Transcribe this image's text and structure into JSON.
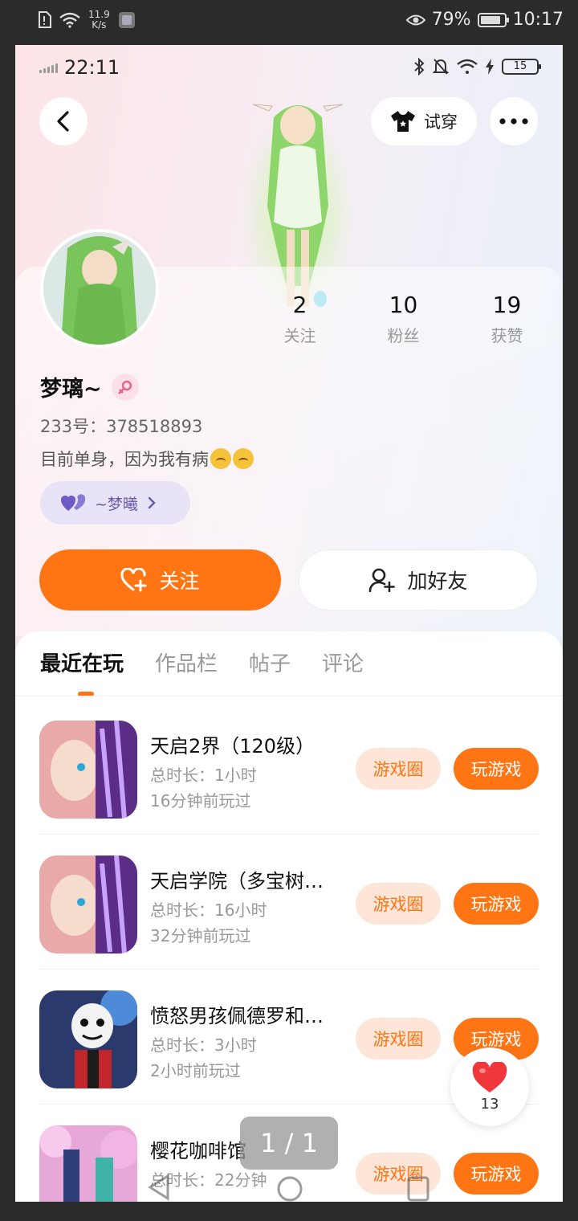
{
  "outer_status": {
    "speed_value": "11.9",
    "speed_unit": "K/s",
    "battery": "79%",
    "time": "10:17"
  },
  "inner_status": {
    "time": "22:11",
    "battery": "15"
  },
  "header": {
    "tryon_label": "试穿"
  },
  "profile": {
    "stats": [
      {
        "value": "2",
        "label": "关注"
      },
      {
        "value": "10",
        "label": "粉丝"
      },
      {
        "value": "19",
        "label": "获赞"
      }
    ],
    "username": "梦璃~",
    "uid": "233号：378518893",
    "bio": "目前单身，因为我有病",
    "relation_name": "~梦曦",
    "follow_label": "关注",
    "add_friend_label": "加好友"
  },
  "tabs": [
    {
      "label": "最近在玩",
      "active": true
    },
    {
      "label": "作品栏",
      "active": false
    },
    {
      "label": "帖子",
      "active": false
    },
    {
      "label": "评论",
      "active": false
    }
  ],
  "games": [
    {
      "title": "天启2界（120级）",
      "duration": "总时长：1小时",
      "last_played": "16分钟前玩过",
      "circle_label": "游戏圈",
      "play_label": "玩游戏"
    },
    {
      "title": "天启学院（多宝树…",
      "duration": "总时长：16小时",
      "last_played": "32分钟前玩过",
      "circle_label": "游戏圈",
      "play_label": "玩游戏"
    },
    {
      "title": "愤怒男孩佩德罗和…",
      "duration": "总时长：3小时",
      "last_played": "2小时前玩过",
      "circle_label": "游戏圈",
      "play_label": "玩游戏"
    },
    {
      "title": "樱花咖啡馆",
      "duration": "总时长：22分钟",
      "last_played": "",
      "circle_label": "游戏圈",
      "play_label": "玩游戏"
    }
  ],
  "like_fab": {
    "count": "13"
  },
  "page_indicator": "1 / 1",
  "colors": {
    "accent": "#ff7514",
    "accent_light": "#fde6d7",
    "relation_chip": "#e8e3f6"
  }
}
